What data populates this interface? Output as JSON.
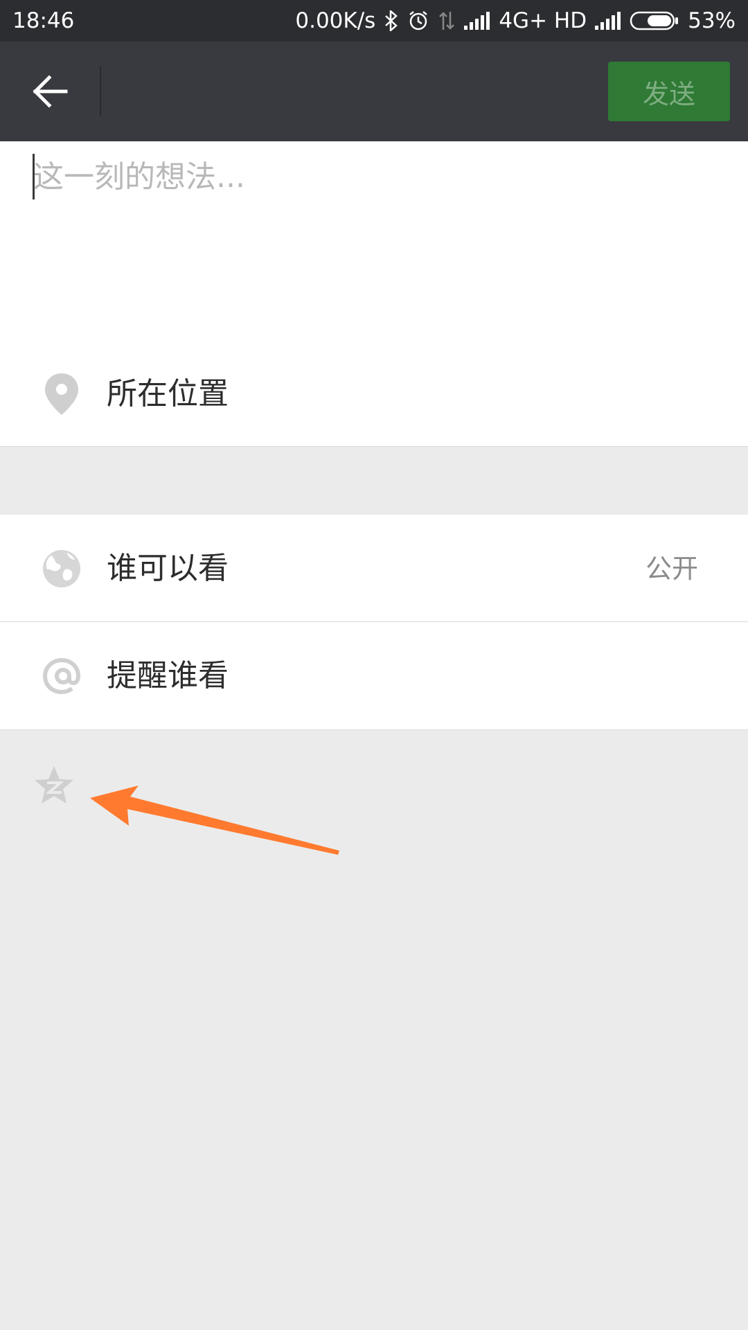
{
  "status_bar": {
    "time": "18:46",
    "network_speed": "0.00K/s",
    "network_type": "4G+ HD",
    "battery": "53%",
    "icons": [
      "bluetooth-icon",
      "alarm-icon",
      "data-transfer-icon",
      "signal-icon",
      "signal-icon",
      "battery-icon"
    ]
  },
  "toolbar": {
    "back_icon": "arrow-left-icon",
    "send_label": "发送",
    "send_color": "#2f7a35"
  },
  "compose": {
    "placeholder": "这一刻的想法..."
  },
  "rows": {
    "location": {
      "label": "所在位置",
      "icon": "location-pin-icon"
    },
    "visibility": {
      "label": "谁可以看",
      "value": "公开",
      "icon": "globe-icon"
    },
    "mention": {
      "label": "提醒谁看",
      "icon": "at-icon"
    }
  },
  "share_options": {
    "qzone_icon": "qzone-star-icon"
  },
  "annotation": {
    "arrow_color": "#ff7a2f"
  }
}
